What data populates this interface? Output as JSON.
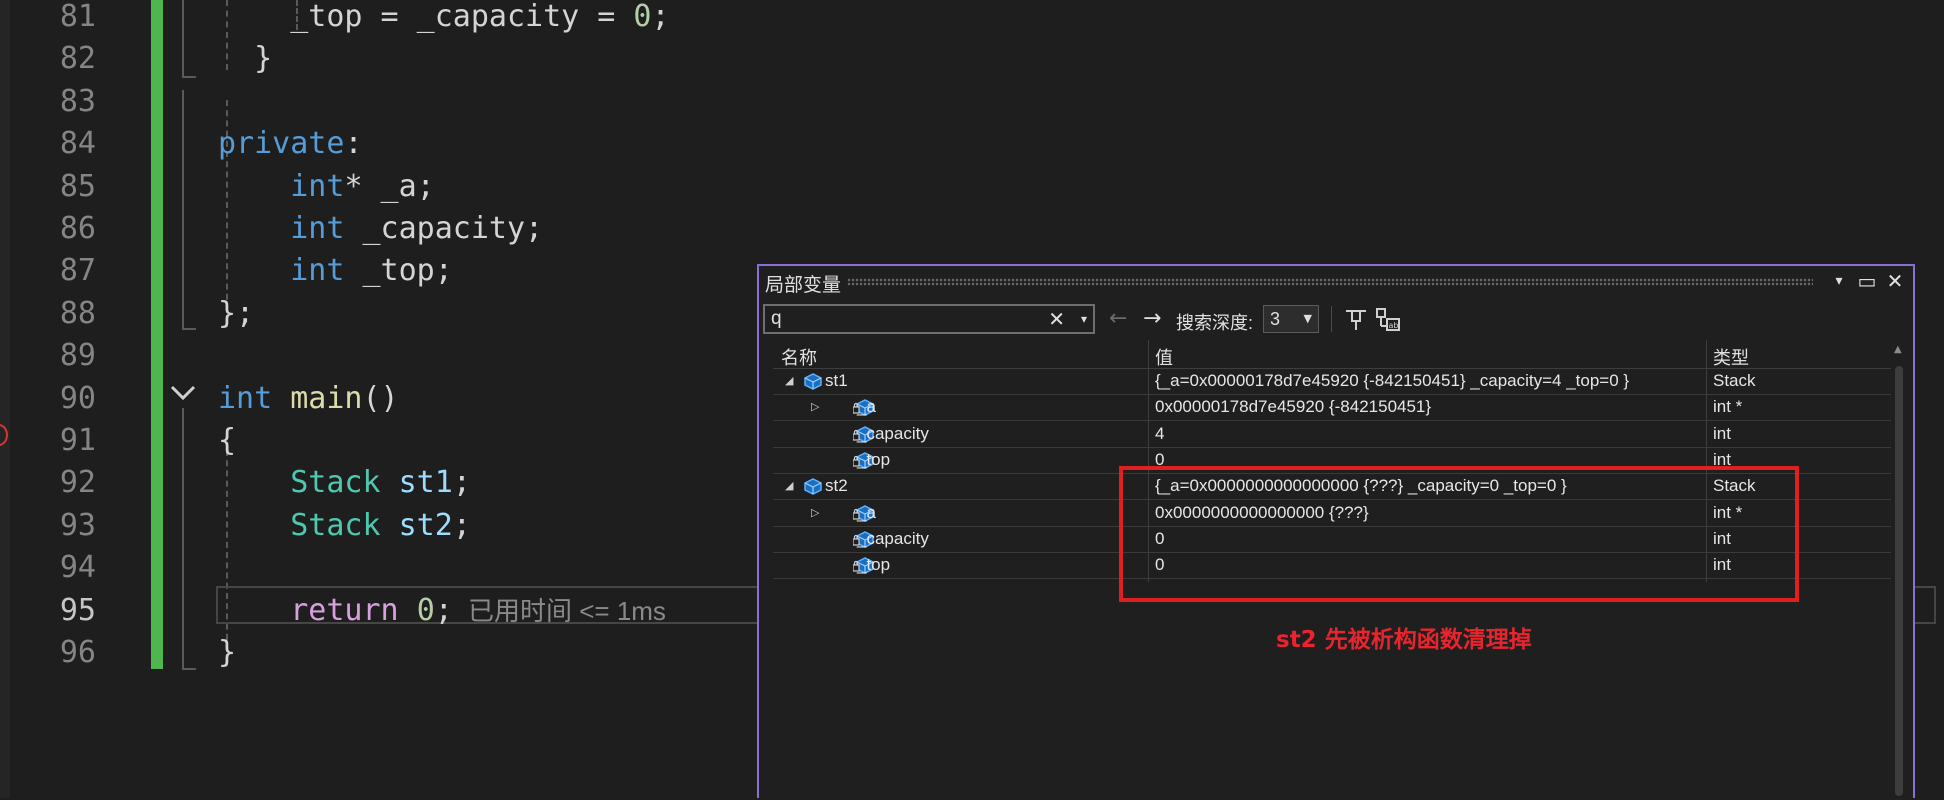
{
  "editor": {
    "lines": [
      {
        "num": "81",
        "tokens": [
          {
            "t": "    ",
            "c": ""
          },
          {
            "t": "_top = _capacity = ",
            "c": ""
          },
          {
            "t": "0",
            "c": "num"
          },
          {
            "t": ";",
            "c": ""
          }
        ]
      },
      {
        "num": "82",
        "tokens": [
          {
            "t": "  }",
            "c": ""
          }
        ]
      },
      {
        "num": "83",
        "tokens": []
      },
      {
        "num": "84",
        "tokens": [
          {
            "t": "private",
            "c": "kw"
          },
          {
            "t": ":",
            "c": ""
          }
        ]
      },
      {
        "num": "85",
        "tokens": [
          {
            "t": "    ",
            "c": ""
          },
          {
            "t": "int",
            "c": "kw"
          },
          {
            "t": "* _a;",
            "c": ""
          }
        ]
      },
      {
        "num": "86",
        "tokens": [
          {
            "t": "    ",
            "c": ""
          },
          {
            "t": "int",
            "c": "kw"
          },
          {
            "t": " _capacity;",
            "c": ""
          }
        ]
      },
      {
        "num": "87",
        "tokens": [
          {
            "t": "    ",
            "c": ""
          },
          {
            "t": "int",
            "c": "kw"
          },
          {
            "t": " _top;",
            "c": ""
          }
        ]
      },
      {
        "num": "88",
        "tokens": [
          {
            "t": "};",
            "c": ""
          }
        ]
      },
      {
        "num": "89",
        "tokens": []
      },
      {
        "num": "90",
        "tokens": [
          {
            "t": "int",
            "c": "kw"
          },
          {
            "t": " ",
            "c": ""
          },
          {
            "t": "main",
            "c": "fn"
          },
          {
            "t": "()",
            "c": ""
          }
        ]
      },
      {
        "num": "91",
        "tokens": [
          {
            "t": "{",
            "c": ""
          }
        ]
      },
      {
        "num": "92",
        "tokens": [
          {
            "t": "    ",
            "c": ""
          },
          {
            "t": "Stack",
            "c": "ty"
          },
          {
            "t": " ",
            "c": ""
          },
          {
            "t": "st1",
            "c": "var"
          },
          {
            "t": ";",
            "c": ""
          }
        ]
      },
      {
        "num": "93",
        "tokens": [
          {
            "t": "    ",
            "c": ""
          },
          {
            "t": "Stack",
            "c": "ty"
          },
          {
            "t": " ",
            "c": ""
          },
          {
            "t": "st2",
            "c": "var"
          },
          {
            "t": ";",
            "c": ""
          }
        ]
      },
      {
        "num": "94",
        "tokens": []
      },
      {
        "num": "95",
        "tokens": [
          {
            "t": "    ",
            "c": ""
          },
          {
            "t": "return",
            "c": "ctl"
          },
          {
            "t": " ",
            "c": ""
          },
          {
            "t": "0",
            "c": "num"
          },
          {
            "t": ";",
            "c": ""
          }
        ],
        "current": true
      },
      {
        "num": "96",
        "tokens": [
          {
            "t": "}",
            "c": ""
          }
        ]
      }
    ],
    "elapsed_hint": "已用时间 <= 1ms"
  },
  "locals_window": {
    "title": "局部变量",
    "search": {
      "value": "q",
      "clear_glyph": "✕",
      "dropdown_glyph": "▾"
    },
    "nav_back_glyph": "←",
    "nav_forward_glyph": "→",
    "search_depth_label": "搜索深度:",
    "search_depth_value": "3",
    "title_buttons": {
      "dropdown": "▾",
      "maximize": "▭",
      "close": "✕"
    },
    "columns": {
      "name": "名称",
      "value": "值",
      "type": "类型"
    },
    "rows": [
      {
        "level": 0,
        "expander": "◢",
        "icon": "object-icon",
        "name": "st1",
        "value": "{_a=0x00000178d7e45920 {-842150451} _capacity=4 _top=0 }",
        "type": "Stack"
      },
      {
        "level": 1,
        "expander": "▷",
        "icon": "private-field-icon",
        "name": "_a",
        "value": "0x00000178d7e45920 {-842150451}",
        "type": "int *"
      },
      {
        "level": 1,
        "expander": "",
        "icon": "private-field-icon",
        "name": "_capacity",
        "value": "4",
        "type": "int"
      },
      {
        "level": 1,
        "expander": "",
        "icon": "private-field-icon",
        "name": "_top",
        "value": "0",
        "type": "int"
      },
      {
        "level": 0,
        "expander": "◢",
        "icon": "object-icon",
        "name": "st2",
        "value": "{_a=0x0000000000000000 {???} _capacity=0 _top=0 }",
        "type": "Stack"
      },
      {
        "level": 1,
        "expander": "▷",
        "icon": "private-field-icon",
        "name": "_a",
        "value": "0x0000000000000000 {???}",
        "type": "int *"
      },
      {
        "level": 1,
        "expander": "",
        "icon": "private-field-icon",
        "name": "_capacity",
        "value": "0",
        "type": "int"
      },
      {
        "level": 1,
        "expander": "",
        "icon": "private-field-icon",
        "name": "_top",
        "value": "0",
        "type": "int"
      }
    ]
  },
  "annotation": {
    "text": "st2 先被析构函数清理掉",
    "color": "#e8242e"
  },
  "colors": {
    "accent_border": "#8a6fd6",
    "change_bar": "#4fb54f",
    "annotation_box": "#e02020"
  }
}
